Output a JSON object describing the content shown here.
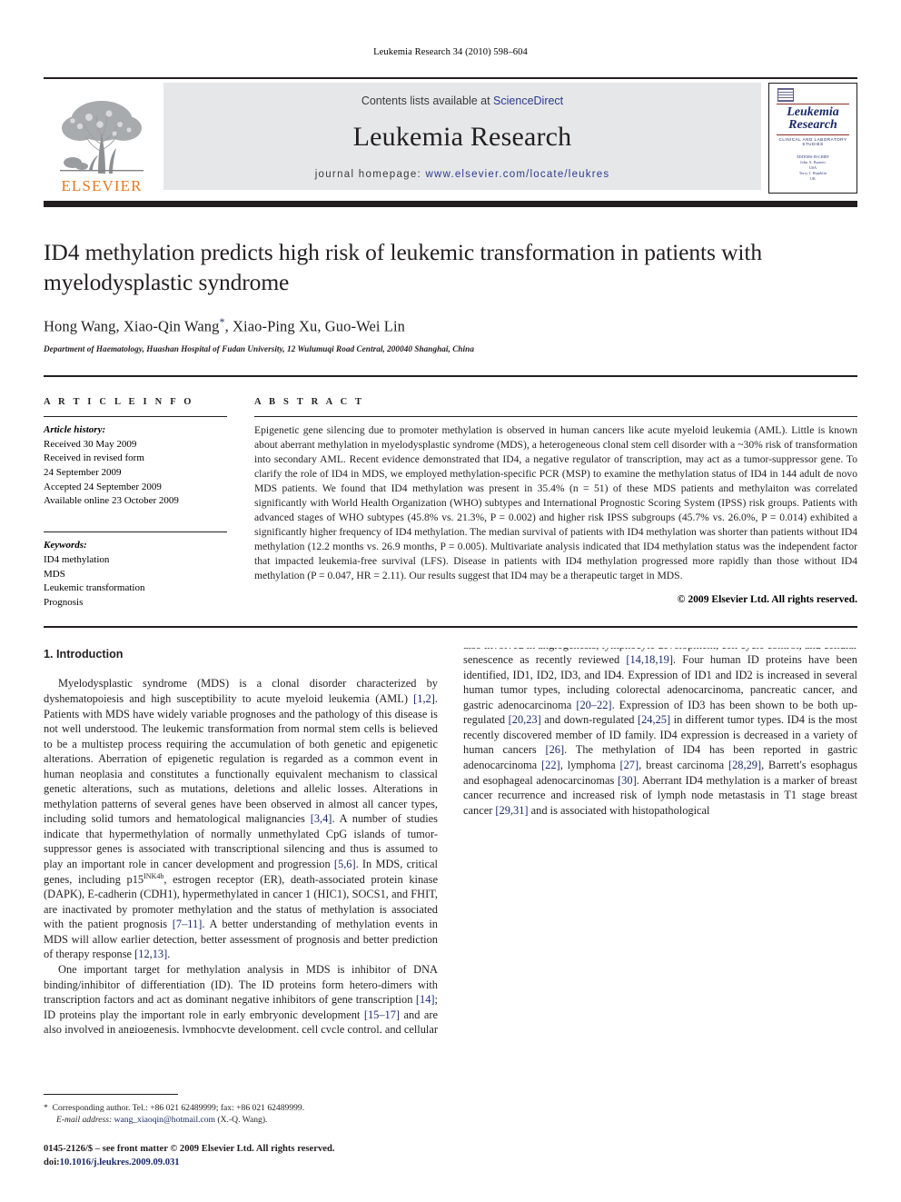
{
  "running_head": "Leukemia Research 34 (2010) 598–604",
  "masthead": {
    "publisher_name": "ELSEVIER",
    "contents_prefix": "Contents lists available at ",
    "sciencedirect_link": "ScienceDirect",
    "journal_title": "Leukemia Research",
    "homepage_prefix": "journal homepage: ",
    "homepage_url": "www.elsevier.com/locate/leukres",
    "cover": {
      "line1": "Leukemia",
      "line2": "Research",
      "subtitle": "CLINICAL AND LABORATORY STUDIES",
      "editors_heading": "EDITORS-IN-CHIEF",
      "editor_1": "John A. Barnett",
      "editor_1_loc": "USA",
      "editor_2": "Terry J. Hamblin",
      "editor_2_loc": "UK"
    }
  },
  "article": {
    "title": "ID4 methylation predicts high risk of leukemic transformation in patients with myelodysplastic syndrome",
    "authors": "Hong Wang, Xiao-Qin Wang",
    "authors_rest": ", Xiao-Ping Xu, Guo-Wei Lin",
    "corresponding_marker": "*",
    "affiliation": "Department of Haematology, Huashan Hospital of Fudan University, 12 Wulumuqi Road Central, 200040 Shanghai, China"
  },
  "article_info": {
    "heading": "A R T I C L E   I N F O",
    "history_label": "Article history:",
    "history": [
      "Received 30 May 2009",
      "Received in revised form",
      "24 September 2009",
      "Accepted 24 September 2009",
      "Available online 23 October 2009"
    ],
    "keywords_label": "Keywords:",
    "keywords": [
      "ID4 methylation",
      "MDS",
      "Leukemic transformation",
      "Prognosis"
    ]
  },
  "abstract": {
    "heading": "A B S T R A C T",
    "text": "Epigenetic gene silencing due to promoter methylation is observed in human cancers like acute myeloid leukemia (AML). Little is known about aberrant methylation in myelodysplastic syndrome (MDS), a heterogeneous clonal stem cell disorder with a ~30% risk of transformation into secondary AML. Recent evidence demonstrated that ID4, a negative regulator of transcription, may act as a tumor-suppressor gene. To clarify the role of ID4 in MDS, we employed methylation-specific PCR (MSP) to examine the methylation status of ID4 in 144 adult de novo MDS patients. We found that ID4 methylation was present in 35.4% (n = 51) of these MDS patients and methylaiton was correlated significantly with World Health Organization (WHO) subtypes and International Prognostic Scoring System (IPSS) risk groups. Patients with advanced stages of WHO subtypes (45.8% vs. 21.3%, P = 0.002) and higher risk IPSS subgroups (45.7% vs. 26.0%, P = 0.014) exhibited a significantly higher frequency of ID4 methylation. The median survival of patients with ID4 methylation was shorter than patients without ID4 methylation (12.2 months vs. 26.9 months, P = 0.005). Multivariate analysis indicated that ID4 methylation status was the independent factor that impacted leukemia-free survival (LFS). Disease in patients with ID4 methylation progressed more rapidly than those without ID4 methylation (P = 0.047, HR = 2.11). Our results suggest that ID4 may be a therapeutic target in MDS.",
    "copyright": "© 2009 Elsevier Ltd. All rights reserved."
  },
  "introduction": {
    "section_title": "1.  Introduction",
    "para1_a": "Myelodysplastic syndrome (MDS) is a clonal disorder characterized by dyshematopoiesis and high susceptibility to acute myeloid leukemia (AML) ",
    "para1_ref1": "[1,2]",
    "para1_b": ". Patients with MDS have widely variable prognoses and the pathology of this disease is not well understood. The leukemic transformation from normal stem cells is believed to be a multistep process requiring the accumulation of both genetic and epigenetic alterations. Aberration of epigenetic regulation is regarded as a common event in human neoplasia and constitutes a functionally equivalent mechanism to classical genetic alterations, such as mutations, deletions and allelic losses. Alterations in methylation patterns of several genes have been observed in almost all cancer types, including solid tumors and hematological malignancies ",
    "para1_ref2": "[3,4]",
    "para1_c": ". A number of studies indicate that hypermethylation of normally unmethylated CpG islands of tumor-suppressor genes is associated with transcriptional silencing and thus is assumed to play an important role in cancer development and progression ",
    "para1_ref3": "[5,6]",
    "para1_d": ". In MDS, critical genes, including p15",
    "para1_sup": "INK4b",
    "para1_e": ", estrogen receptor (ER), death-associated protein kinase (DAPK), E-cadherin (CDH1), hypermethylated in cancer 1 (HIC1), SOCS1, and FHIT, are inactivated by promoter methylation and the status of methylation is associated with the patient prognosis ",
    "para1_ref4": "[7–11]",
    "para1_f": ". A better understanding of methylation events in MDS will allow earlier detection, better assessment of prognosis and better prediction of therapy response ",
    "para1_ref5": "[12,13]",
    "para1_g": ".",
    "para2_a": "One important target for methylation analysis in MDS is inhibitor of DNA binding/inhibitor of differentiation (ID). The ID proteins form hetero-dimers with transcription factors and act as dominant negative inhibitors of gene transcription ",
    "para2_ref1": "[14]",
    "para2_b": "; ID proteins play the important role in early embryonic development ",
    "para2_ref2": "[15–17]",
    "para2_c": " and are also involved in angiogenesis, lymphocyte development, cell cycle control, and cellular senescence as recently reviewed ",
    "para2_ref3": "[14,18,19]",
    "para2_d": ". Four human ID proteins have been identified, ID1, ID2, ID3, and ID4. Expression of ID1 and ID2 is increased in several human tumor types, including colorectal adenocarcinoma, pancreatic cancer, and gastric adenocarcinoma ",
    "para2_ref4": "[20–22]",
    "para2_e": ". Expression of ID3 has been shown to be both up-regulated ",
    "para2_ref5": "[20,23]",
    "para2_f": " and down-regulated ",
    "para2_ref6": "[24,25]",
    "para2_g": " in different tumor types. ID4 is the most recently discovered member of ID family. ID4 expression is decreased in a variety of human cancers ",
    "para2_ref7": "[26]",
    "para2_h": ". The methylation of ID4 has been reported in gastric adenocarcinoma ",
    "para2_ref8": "[22]",
    "para2_i": ", lymphoma ",
    "para2_ref9": "[27]",
    "para2_j": ", breast carcinoma ",
    "para2_ref10": "[28,29]",
    "para2_k": ", Barrett's esophagus and esophageal adenocarcinomas ",
    "para2_ref11": "[30]",
    "para2_l": ". Aberrant ID4 methylation is a marker of breast cancer recurrence and increased risk of lymph node metastasis in T1 stage breast cancer ",
    "para2_ref12": "[29,31]",
    "para2_m": " and is associated with histopathological"
  },
  "footnote": {
    "star": "*",
    "corresponding": "Corresponding author. Tel.: +86 021 62489999; fax: +86 021 62489999.",
    "email_label": "E-mail address:",
    "email": "wang_xiaoqin@hotmail.com",
    "email_suffix": " (X.-Q. Wang).",
    "issn_line": "0145-2126/$ – see front matter © 2009 Elsevier Ltd. All rights reserved.",
    "doi_label": "doi:",
    "doi_value": "10.1016/j.leukres.2009.09.031"
  },
  "colors": {
    "link_blue": "#2b3a8f",
    "ref_blue": "#1b2a6b",
    "elsevier_orange": "#e87722",
    "band_grey": "#e6e7e8",
    "rule_black": "#231f20"
  }
}
